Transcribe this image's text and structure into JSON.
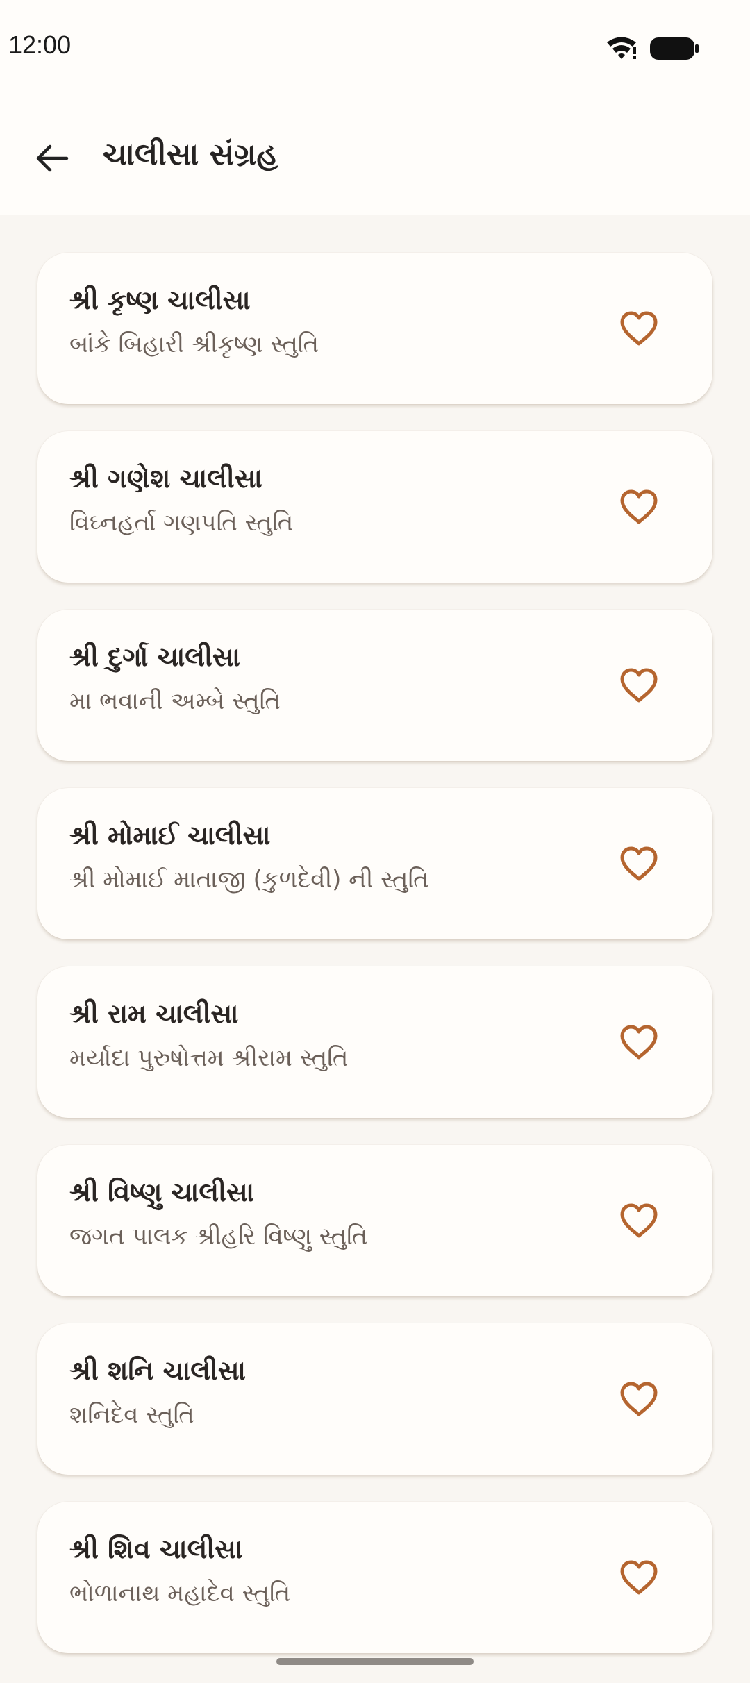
{
  "status_bar": {
    "time": "12:00"
  },
  "app_bar": {
    "title": "ચાલીસા સંગ્રહ"
  },
  "colors": {
    "accent": "#b5652f",
    "background": "#f9f6f2",
    "surface": "#fffdfa",
    "title_text": "#2a2523",
    "subtitle_text": "#6b6059"
  },
  "items": [
    {
      "title": "શ્રી કૃષ્ણ ચાલીસા",
      "subtitle": "બાંકે બિહારી શ્રીકૃષ્ણ સ્તુતિ",
      "icon": "heart-outline-icon"
    },
    {
      "title": "શ્રી ગણેશ ચાલીસા",
      "subtitle": "વિઘ્નહર્તા ગણપતિ સ્તુતિ",
      "icon": "heart-outline-icon"
    },
    {
      "title": "શ્રી દુર્ગા ચાલીસા",
      "subtitle": "મા ભવાની અમ્બે સ્તુતિ",
      "icon": "heart-outline-icon"
    },
    {
      "title": "શ્રી મોમાઈ ચાલીસા",
      "subtitle": "શ્રી મોમાઈ માતાજી (કુળદેવી) ની સ્તુતિ",
      "icon": "heart-outline-icon"
    },
    {
      "title": "શ્રી રામ ચાલીસા",
      "subtitle": "મર્યાદા પુરુષોત્તમ શ્રીરામ સ્તુતિ",
      "icon": "heart-outline-icon"
    },
    {
      "title": "શ્રી વિષ્ણુ ચાલીસા",
      "subtitle": "જગત પાલક શ્રીહરિ વિષ્ણુ સ્તુતિ",
      "icon": "heart-outline-icon"
    },
    {
      "title": "શ્રી શનિ ચાલીસા",
      "subtitle": "શનિદેવ સ્તુતિ",
      "icon": "heart-outline-icon"
    },
    {
      "title": "શ્રી શિવ ચાલીસા",
      "subtitle": "ભોળાનાથ મહાદેવ સ્તુતિ",
      "icon": "heart-outline-icon"
    }
  ]
}
